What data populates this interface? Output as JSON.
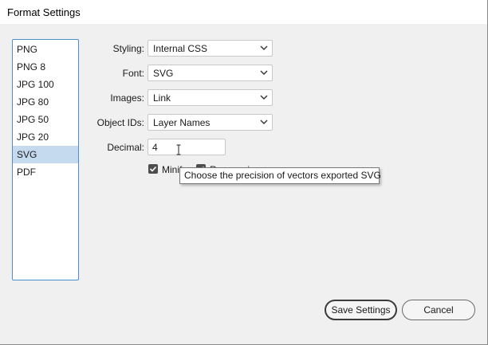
{
  "window": {
    "title": "Format Settings"
  },
  "formats": {
    "items": [
      "PNG",
      "PNG 8",
      "JPG 100",
      "JPG 80",
      "JPG 50",
      "JPG 20",
      "SVG",
      "PDF"
    ],
    "selected": "SVG"
  },
  "settings": {
    "styling": {
      "label": "Styling:",
      "value": "Internal CSS"
    },
    "font": {
      "label": "Font:",
      "value": "SVG"
    },
    "images": {
      "label": "Images:",
      "value": "Link"
    },
    "object_ids": {
      "label": "Object IDs:",
      "value": "Layer Names"
    },
    "decimal": {
      "label": "Decimal:",
      "value": "4"
    },
    "minify": {
      "label": "Minify",
      "checked": true
    },
    "responsive": {
      "label": "Responsive",
      "checked": true
    }
  },
  "tooltip": {
    "text": "Choose the precision of vectors exported SVG"
  },
  "buttons": {
    "save": "Save Settings",
    "cancel": "Cancel"
  }
}
